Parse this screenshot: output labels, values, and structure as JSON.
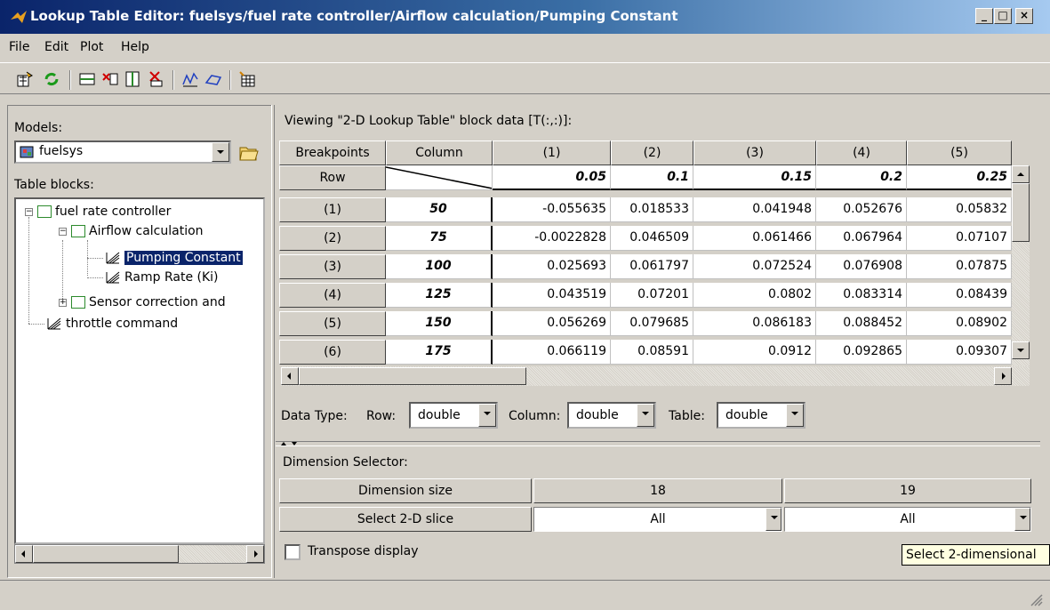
{
  "window": {
    "title": "Lookup Table Editor: fuelsys/fuel rate controller/Airflow calculation/Pumping Constant"
  },
  "menu": [
    "File",
    "Edit",
    "Plot",
    "Help"
  ],
  "toolbar": {
    "icons": [
      "update-block-icon",
      "reload-icon",
      "add-row-icon",
      "remove-row-icon",
      "add-column-icon",
      "remove-column-icon",
      "plot-line-icon",
      "plot-mesh-icon",
      "edit-table-icon"
    ]
  },
  "left": {
    "models_label": "Models:",
    "model_value": "fuelsys",
    "table_blocks_label": "Table blocks:",
    "tree": [
      {
        "label": "fuel rate controller"
      },
      {
        "label": "Airflow calculation"
      },
      {
        "label": "Pumping Constant"
      },
      {
        "label": "Ramp Rate (Ki)"
      },
      {
        "label": "Sensor correction and"
      },
      {
        "label": "throttle command"
      }
    ]
  },
  "right": {
    "viewing_label": "Viewing \"2-D Lookup Table\" block data [T(:,:)]:",
    "header": [
      "Breakpoints",
      "Column",
      "(1)",
      "(2)",
      "(3)",
      "(4)",
      "(5)"
    ],
    "row_header_label": "Row",
    "col_breakpoints": [
      "0.05",
      "0.1",
      "0.15",
      "0.2",
      "0.25"
    ],
    "rows": [
      {
        "idx": "(1)",
        "bp": "50",
        "values": [
          "-0.055635",
          "0.018533",
          "0.041948",
          "0.052676",
          "0.05832"
        ]
      },
      {
        "idx": "(2)",
        "bp": "75",
        "values": [
          "-0.0022828",
          "0.046509",
          "0.061466",
          "0.067964",
          "0.07107"
        ]
      },
      {
        "idx": "(3)",
        "bp": "100",
        "values": [
          "0.025693",
          "0.061797",
          "0.072524",
          "0.076908",
          "0.07875"
        ]
      },
      {
        "idx": "(4)",
        "bp": "125",
        "values": [
          "0.043519",
          "0.07201",
          "0.0802",
          "0.083314",
          "0.08439"
        ]
      },
      {
        "idx": "(5)",
        "bp": "150",
        "values": [
          "0.056269",
          "0.079685",
          "0.086183",
          "0.088452",
          "0.08902"
        ]
      },
      {
        "idx": "(6)",
        "bp": "175",
        "values": [
          "0.066119",
          "0.08591",
          "0.0912",
          "0.092865",
          "0.09307"
        ]
      }
    ],
    "data_type": {
      "label": "Data Type:",
      "row_label": "Row:",
      "row_value": "double",
      "column_label": "Column:",
      "column_value": "double",
      "table_label": "Table:",
      "table_value": "double"
    },
    "dimension_selector": {
      "label": "Dimension Selector:",
      "size_label": "Dimension size",
      "sizes": [
        "18",
        "19"
      ],
      "slice_label": "Select 2-D slice",
      "slices": [
        "All",
        "All"
      ]
    },
    "transpose_label": "Transpose display",
    "transpose_checked": false,
    "tooltip": "Select 2-dimensional"
  }
}
